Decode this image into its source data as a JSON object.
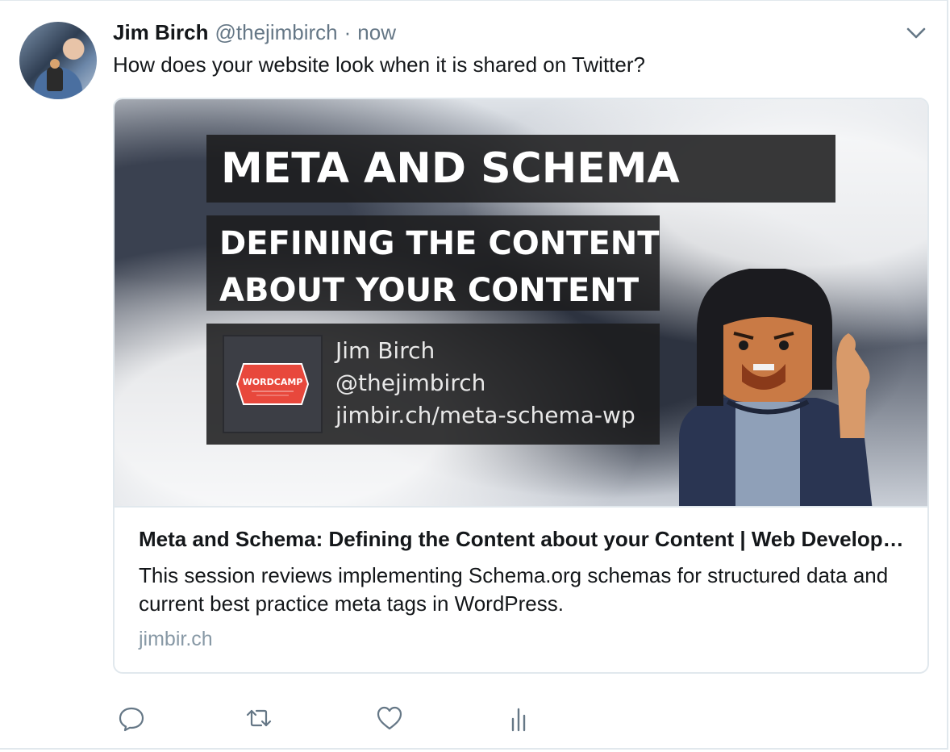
{
  "tweet": {
    "author_name": "Jim Birch",
    "author_handle": "@thejimbirch",
    "separator": "·",
    "timestamp": "now",
    "text": "How does your website look when it is shared on Twitter?"
  },
  "card": {
    "image": {
      "heading": "META AND SCHEMA",
      "subheading_line1": "DEFINING THE CONTENT",
      "subheading_line2": "ABOUT YOUR CONTENT",
      "logo_text": "WORDCAMP",
      "presenter_name": "Jim Birch",
      "presenter_handle": "@thejimbirch",
      "presenter_url": "jimbir.ch/meta-schema-wp"
    },
    "title": "Meta and Schema: Defining the Content about your Content | Web Developer | Jim Birch",
    "description": "This session reviews implementing Schema.org schemas for structured data and current best practice meta tags in WordPress.",
    "domain": "jimbir.ch"
  },
  "icons": {
    "more": "chevron-down-icon",
    "reply": "reply-icon",
    "retweet": "retweet-icon",
    "like": "heart-icon",
    "analytics": "analytics-icon"
  },
  "colors": {
    "text_primary": "#14171a",
    "text_secondary": "#657786",
    "border": "#e1e8ed",
    "domain": "#8899a6",
    "icon": "#657786",
    "logo_red": "#e8483c"
  }
}
